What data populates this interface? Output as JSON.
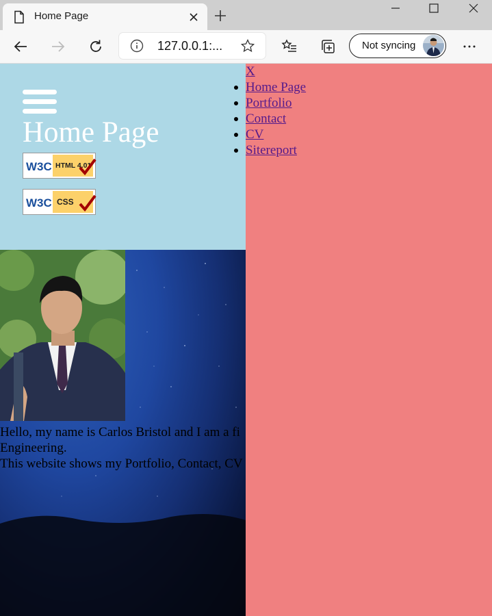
{
  "browser": {
    "tab_title": "Home Page",
    "address": "127.0.0.1:...",
    "sync_label": "Not syncing",
    "icons": [
      "page-icon",
      "close-icon",
      "plus-icon",
      "minimize-icon",
      "maximize-icon",
      "close-window-icon",
      "back-icon",
      "forward-icon",
      "refresh-icon",
      "info-icon",
      "star-icon",
      "favorites-icon",
      "collections-icon",
      "more-icon"
    ]
  },
  "page": {
    "title": "Home Page",
    "badges": [
      {
        "label_left": "W3C",
        "label_right": "HTML 4.01"
      },
      {
        "label_left": "W3C",
        "label_right": "CSS"
      }
    ],
    "intro_lines": [
      "Hello, my name is Carlos Bristol and I am a fi",
      "Engineering.",
      "This website shows my Portfolio, Contact, CV"
    ],
    "nav": {
      "close_label": "X",
      "items": [
        "Home Page",
        "Portfolio",
        "Contact",
        "CV",
        "Sitereport"
      ]
    },
    "colors": {
      "header_bg": "#add8e6",
      "sidenav_bg": "#f08080",
      "link": "#551a8b"
    }
  }
}
